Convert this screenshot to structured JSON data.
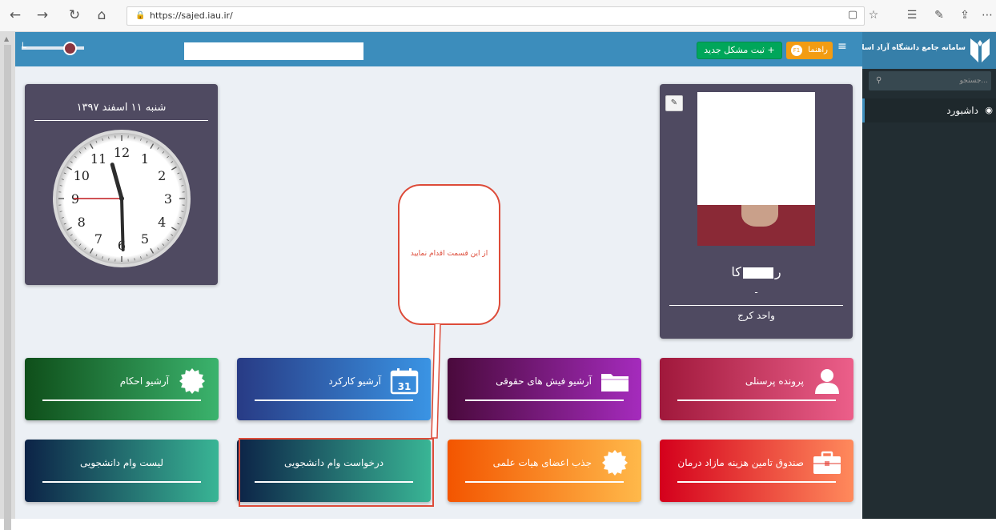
{
  "browser": {
    "url": "https://sajed.iau.ir/"
  },
  "sidebar": {
    "brand_title": "سامانه جامع دانشگاه آزاد اسلامی",
    "search_placeholder": "جستجو...",
    "menu": [
      {
        "label": "داشبورد",
        "icon": "dashboard-icon"
      }
    ]
  },
  "topbar": {
    "user_name": "ـا",
    "new_issue_label": "ثبت مشکل جدید +",
    "help_label": "راهنما",
    "help_badge": "F1"
  },
  "profile": {
    "name_prefix": "ر",
    "name_suffix": "کا",
    "dash": "-",
    "unit": "واحد کرج"
  },
  "clock": {
    "date": "شنبه ۱۱ اسفند ۱۳۹۷",
    "time_display": "11:29",
    "hour": 11,
    "minute": 29,
    "second": 45
  },
  "callout": {
    "text": "از این قسمت اقدام نمایید"
  },
  "tiles": {
    "row1": [
      {
        "label": "پرونده پرسنلی",
        "icon": "user-icon",
        "from": "#a0183b",
        "to": "#ec5f8a"
      },
      {
        "label": "آرشیو فیش های حقوقی",
        "icon": "folder-icon",
        "from": "#4a0a3c",
        "to": "#a52bbd"
      },
      {
        "label": "آرشیو کارکرد",
        "icon": "calendar-icon",
        "from": "#283b85",
        "to": "#3a94e4"
      },
      {
        "label": "آرشیو احکام",
        "icon": "certificate-icon",
        "from": "#0f4f1a",
        "to": "#3bb36d"
      }
    ],
    "row2": [
      {
        "label": "صندوق تامین هزینه مازاد درمان",
        "icon": "briefcase-icon",
        "from": "#d4001c",
        "to": "#ff8a5c"
      },
      {
        "label": "جذب اعضای هیات علمی",
        "icon": "certificate-icon",
        "from": "#f35500",
        "to": "#ffb94a"
      },
      {
        "label": "درخواست وام دانشجویی",
        "icon": "",
        "from": "#0c2347",
        "to": "#39b595"
      },
      {
        "label": "لیست وام دانشجویی",
        "icon": "",
        "from": "#0c2347",
        "to": "#39b595"
      }
    ],
    "calendar_day": "31"
  }
}
